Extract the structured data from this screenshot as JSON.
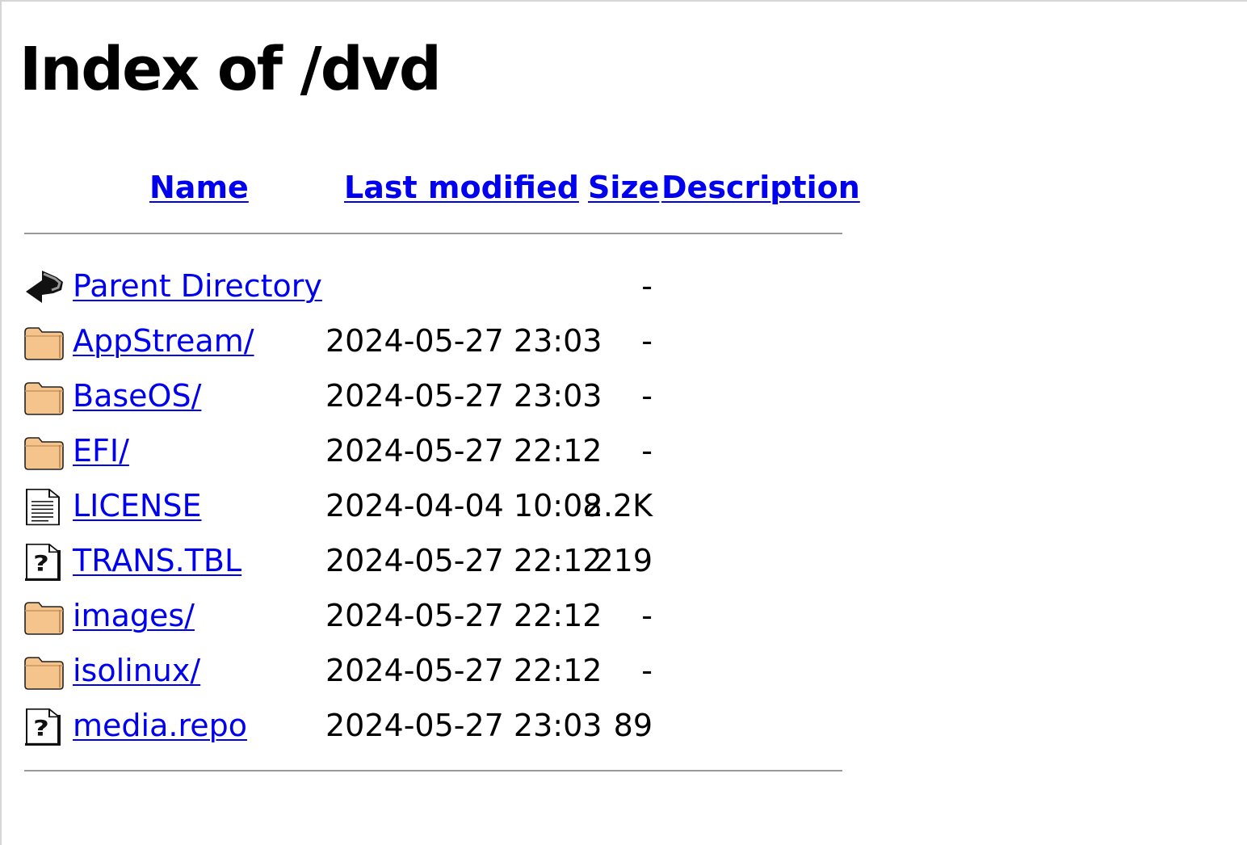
{
  "title": "Index of /dvd",
  "columns": {
    "name": "Name",
    "last_modified": "Last modified",
    "size": "Size",
    "description": "Description"
  },
  "entries": [
    {
      "icon": "back-arrow-icon",
      "name": "Parent Directory",
      "modified": "",
      "size": "-",
      "description": ""
    },
    {
      "icon": "folder-icon",
      "name": "AppStream/",
      "modified": "2024-05-27 23:03",
      "size": "-",
      "description": ""
    },
    {
      "icon": "folder-icon",
      "name": "BaseOS/",
      "modified": "2024-05-27 23:03",
      "size": "-",
      "description": ""
    },
    {
      "icon": "folder-icon",
      "name": "EFI/",
      "modified": "2024-05-27 22:12",
      "size": "-",
      "description": ""
    },
    {
      "icon": "text-file-icon",
      "name": "LICENSE",
      "modified": "2024-04-04 10:08",
      "size": "2.2K",
      "description": ""
    },
    {
      "icon": "unknown-file-icon",
      "name": "TRANS.TBL",
      "modified": "2024-05-27 22:12",
      "size": "219",
      "description": ""
    },
    {
      "icon": "folder-icon",
      "name": "images/",
      "modified": "2024-05-27 22:12",
      "size": "-",
      "description": ""
    },
    {
      "icon": "folder-icon",
      "name": "isolinux/",
      "modified": "2024-05-27 22:12",
      "size": "-",
      "description": ""
    },
    {
      "icon": "unknown-file-icon",
      "name": "media.repo",
      "modified": "2024-05-27 23:03",
      "size": "89",
      "description": ""
    }
  ],
  "colors": {
    "link": "#0000ee",
    "folder": "#f4c48c",
    "rule": "#9a9a9a"
  }
}
